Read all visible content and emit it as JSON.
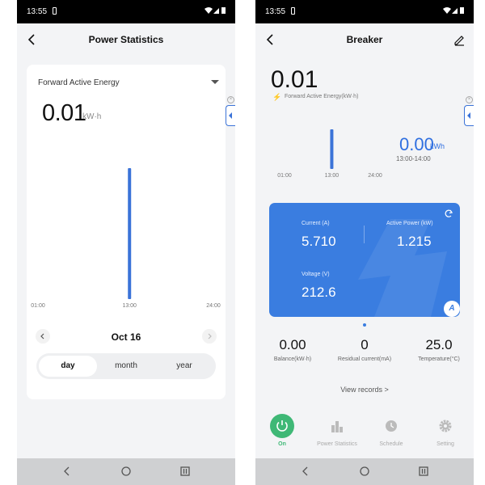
{
  "status": {
    "time": "13:55"
  },
  "left": {
    "header": {
      "title": "Power Statistics"
    },
    "selector": {
      "label": "Forward Active Energy"
    },
    "reading": {
      "value": "0.01",
      "unit": "kW·h"
    },
    "chart_data": {
      "type": "bar",
      "x_ticks": [
        "01:00",
        "13:00",
        "24:00"
      ],
      "x": [
        "13:00"
      ],
      "values": [
        0.01
      ],
      "ylim": [
        0,
        0.01
      ],
      "grid": false,
      "color": "#3b73d8"
    },
    "date": {
      "label": "Oct 16"
    },
    "period_tabs": [
      {
        "label": "day",
        "active": true
      },
      {
        "label": "month",
        "active": false
      },
      {
        "label": "year",
        "active": false
      }
    ]
  },
  "right": {
    "header": {
      "title": "Breaker"
    },
    "reading": {
      "value": "0.01",
      "caption": "Forward Active Energy(kW·h)"
    },
    "chart_data": {
      "type": "bar",
      "x_ticks": [
        "01:00",
        "13:00",
        "24:00"
      ],
      "x": [
        "13:00"
      ],
      "values": [
        0.01
      ],
      "grid": false,
      "color": "#3b73d8"
    },
    "selected": {
      "value": "0.00",
      "unit": "kWh",
      "range": "13:00-14:00"
    },
    "metrics": {
      "current_label": "Current (A)",
      "current_value": "5.710",
      "power_label": "Active Power (kW)",
      "power_value": "1.215",
      "voltage_label": "Voltage (V)",
      "voltage_value": "212.6",
      "badge": "A"
    },
    "stats": [
      {
        "value": "0.00",
        "label": "Balance(kW·h)"
      },
      {
        "value": "0",
        "label": "Residual current(mA)"
      },
      {
        "value": "25.0",
        "label": "Temperature(°C)"
      }
    ],
    "view_records": "View records >",
    "tabs": [
      {
        "label": "On",
        "icon": "power-icon",
        "active": true
      },
      {
        "label": "Power Statistics",
        "icon": "bar-chart-icon",
        "active": false
      },
      {
        "label": "Schedule",
        "icon": "clock-icon",
        "active": false
      },
      {
        "label": "Setting",
        "icon": "gear-icon",
        "active": false
      }
    ]
  },
  "colors": {
    "accent": "#3b73d8",
    "card": "#3a7de0",
    "on": "#3fb876"
  }
}
